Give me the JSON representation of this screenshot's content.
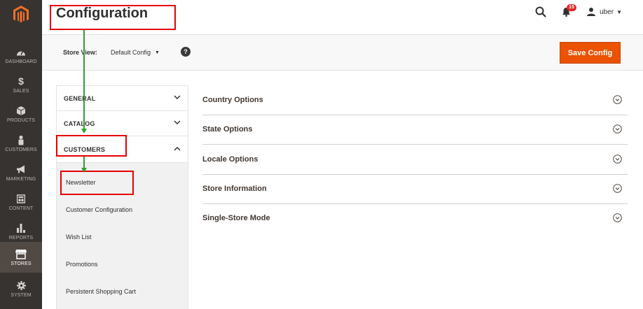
{
  "header": {
    "title": "Configuration",
    "notification_count": "15",
    "user_name": "uber"
  },
  "sidebar": {
    "items": [
      {
        "label": "DASHBOARD",
        "icon": "speedometer-icon"
      },
      {
        "label": "SALES",
        "icon": "dollar-icon"
      },
      {
        "label": "PRODUCTS",
        "icon": "cube-icon"
      },
      {
        "label": "CUSTOMERS",
        "icon": "person-icon"
      },
      {
        "label": "MARKETING",
        "icon": "megaphone-icon"
      },
      {
        "label": "CONTENT",
        "icon": "layout-icon"
      },
      {
        "label": "REPORTS",
        "icon": "bar-chart-icon"
      },
      {
        "label": "STORES",
        "icon": "storefront-icon",
        "active": true
      },
      {
        "label": "SYSTEM",
        "icon": "gear-icon"
      }
    ]
  },
  "toolbar": {
    "store_view_label": "Store View:",
    "store_view_value": "Default Config",
    "help_glyph": "?",
    "save_label": "Save Config"
  },
  "config_menu": {
    "sections": [
      {
        "title": "GENERAL",
        "expanded": false
      },
      {
        "title": "CATALOG",
        "expanded": false
      },
      {
        "title": "CUSTOMERS",
        "expanded": true
      }
    ],
    "customers_items": [
      "Newsletter",
      "Customer Configuration",
      "Wish List",
      "Promotions",
      "Persistent Shopping Cart"
    ]
  },
  "panel": {
    "groups": [
      "Country Options",
      "State Options",
      "Locale Options",
      "Store Information",
      "Single-Store Mode"
    ]
  },
  "colors": {
    "sidebar_bg": "#373330",
    "sidebar_active": "#514943",
    "accent": "#eb5202",
    "annotation_box": "#e60000",
    "annotation_arrow": "#2ea02e"
  }
}
